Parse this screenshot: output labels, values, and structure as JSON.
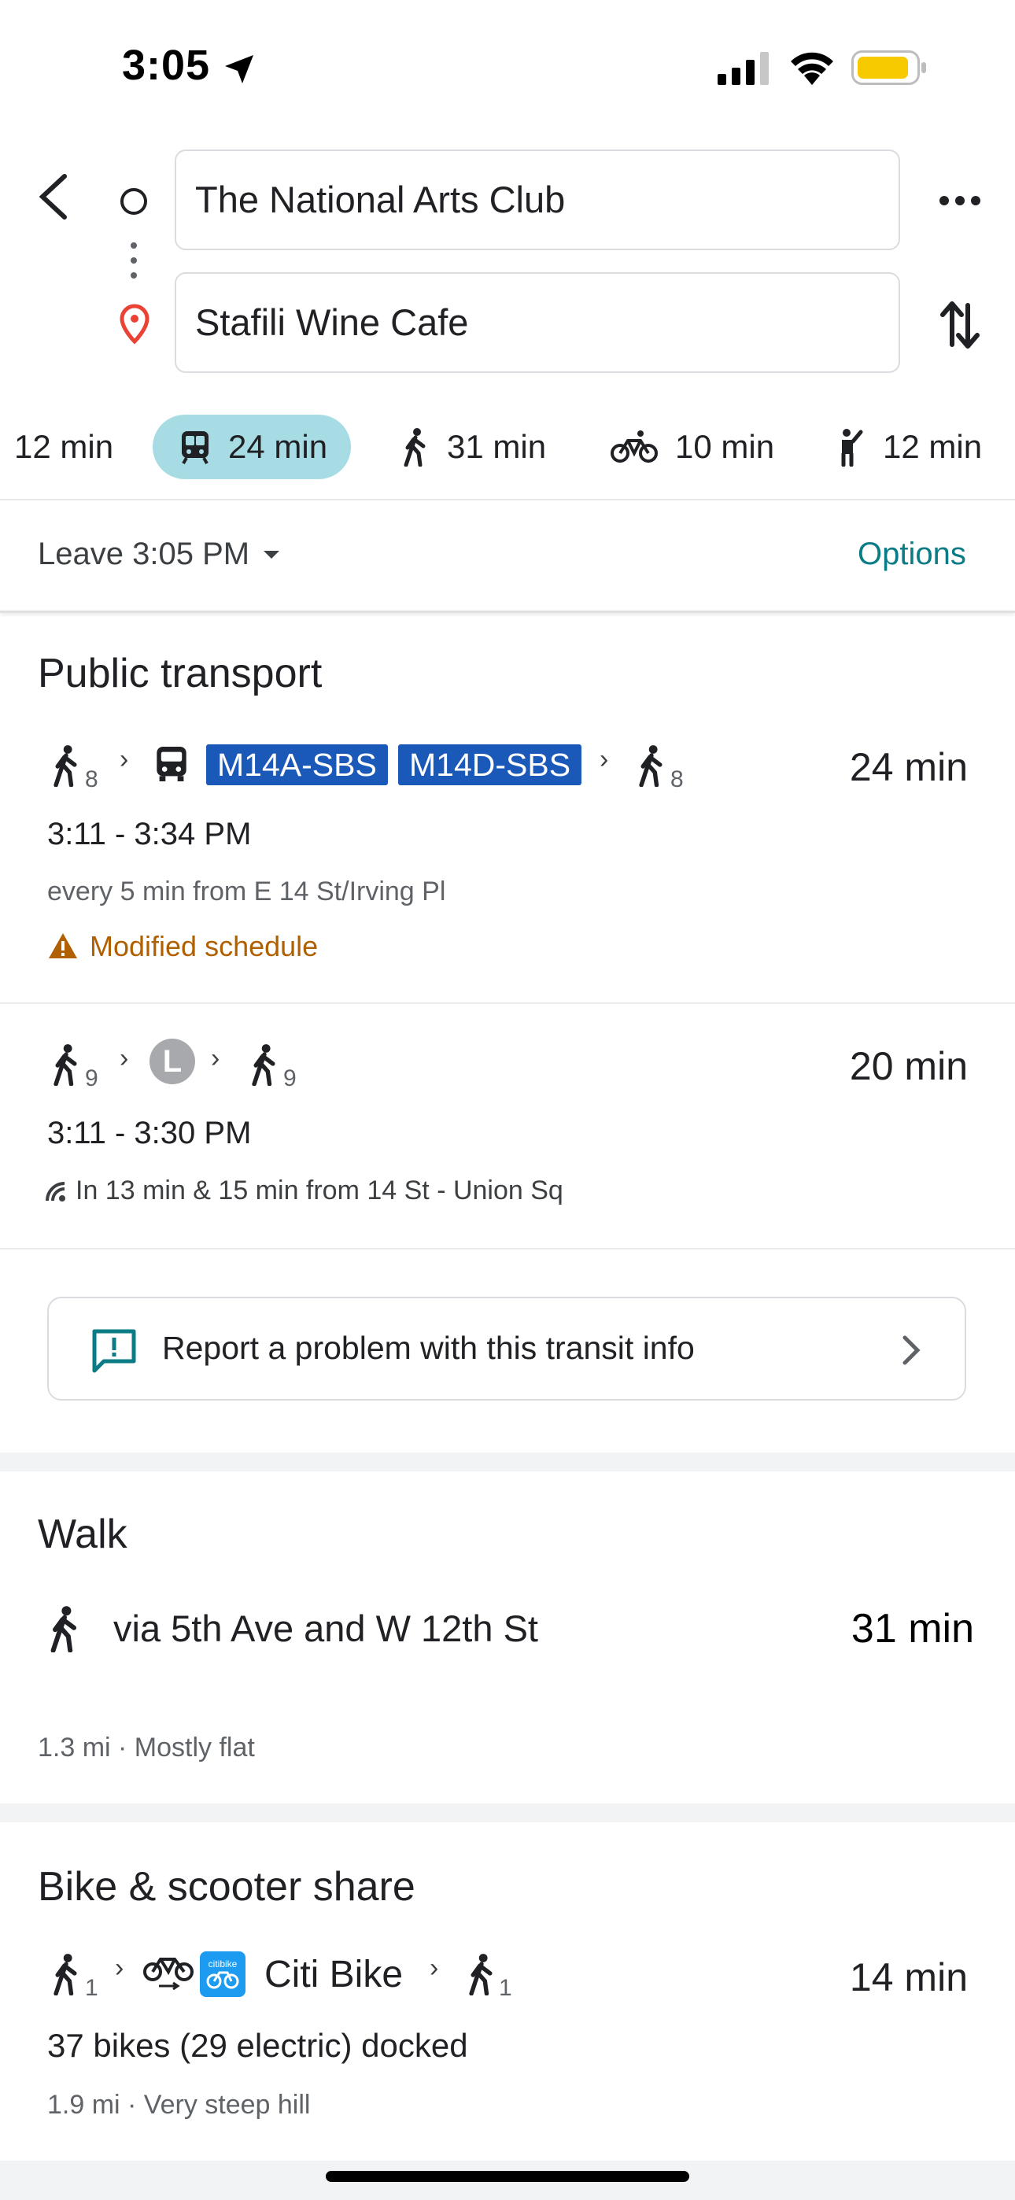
{
  "status_bar": {
    "time": "3:05"
  },
  "search": {
    "origin": "The National Arts Club",
    "destination": "Stafili Wine Cafe"
  },
  "modes": [
    {
      "label": "12 min",
      "icon": "car-icon"
    },
    {
      "label": "24 min",
      "icon": "transit-icon",
      "active": true
    },
    {
      "label": "31 min",
      "icon": "walk-icon"
    },
    {
      "label": "10 min",
      "icon": "bike-icon"
    },
    {
      "label": "12 min",
      "icon": "ride-hail-icon"
    }
  ],
  "leave": {
    "label": "Leave 3:05 PM",
    "options_label": "Options"
  },
  "public_transport": {
    "title": "Public transport",
    "routes": [
      {
        "walk_before": "8",
        "badges": [
          "M14A-SBS",
          "M14D-SBS"
        ],
        "walk_after": "8",
        "duration": "24 min",
        "time_range": "3:11 - 3:34 PM",
        "frequency": "every 5 min from E 14 St/Irving Pl",
        "alert": "Modified schedule"
      },
      {
        "walk_before": "9",
        "line": "L",
        "walk_after": "9",
        "duration": "20 min",
        "time_range": "3:11 - 3:30 PM",
        "realtime": "In 13 min & 15 min from 14 St - Union Sq"
      }
    ],
    "report_label": "Report a problem with this transit info"
  },
  "walk": {
    "title": "Walk",
    "via": "via 5th Ave and W 12th St",
    "duration": "31 min",
    "details": "1.3 mi · Mostly flat"
  },
  "bike_share": {
    "title": "Bike & scooter share",
    "walk_before": "1",
    "service": "Citi Bike",
    "walk_after": "1",
    "duration": "14 min",
    "availability": "37 bikes (29 electric) docked",
    "details": "1.9 mi · Very steep hill"
  },
  "colors": {
    "accent": "#0b7c85",
    "active_tab": "#a8dce5",
    "transit_badge": "#1b59b9",
    "warning": "#b06000",
    "battery": "#f7ca00"
  }
}
